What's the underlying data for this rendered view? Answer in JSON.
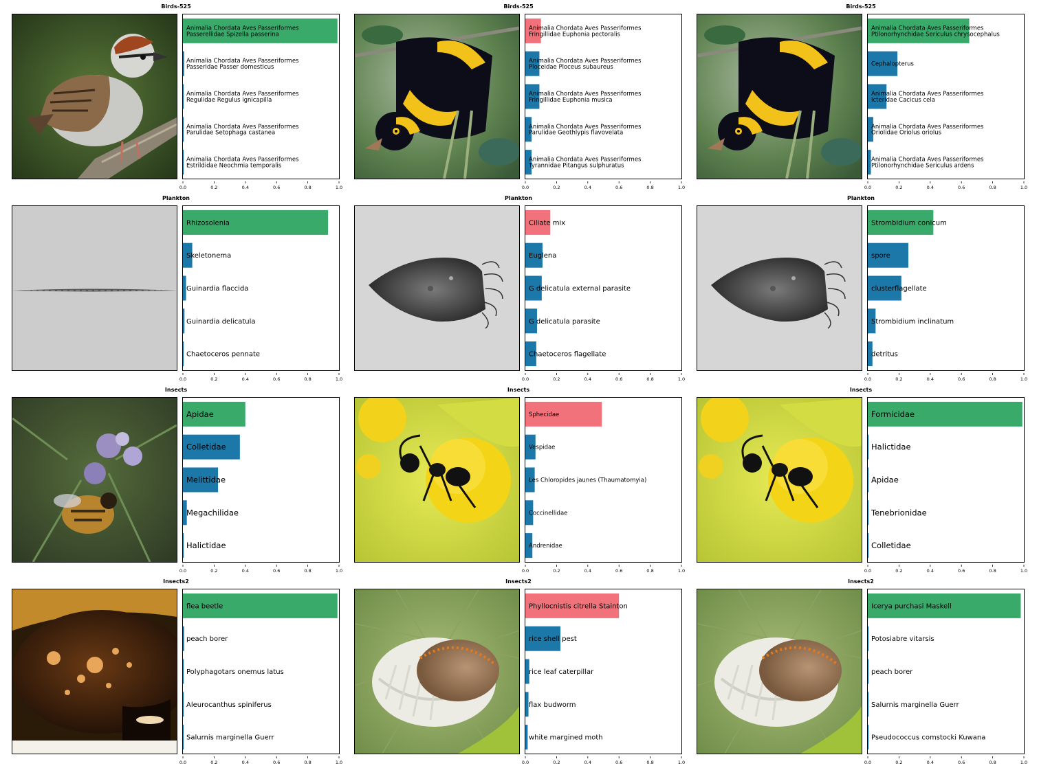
{
  "colors": {
    "correct": "#3aaa6b",
    "wrong": "#f2727c",
    "other": "#1c78a8"
  },
  "chart_data": [
    {
      "type": "bar",
      "title": "Birds-525",
      "image": "chipping-sparrow-photo",
      "xlim": [
        0,
        1
      ],
      "xticks": [
        "0.0",
        "0.2",
        "0.4",
        "0.6",
        "0.8",
        "1.0"
      ],
      "label_size": "small",
      "bars": [
        {
          "label": [
            "Animalia Chordata Aves Passeriformes",
            "Passerellidae Spizella passerina"
          ],
          "value": 0.99,
          "status": "correct"
        },
        {
          "label": [
            "Animalia Chordata Aves Passeriformes",
            "Passeridae Passer domesticus"
          ],
          "value": 0.008,
          "status": "other"
        },
        {
          "label": [
            "Animalia Chordata Aves Passeriformes",
            "Regulidae Regulus ignicapilla"
          ],
          "value": 0.005,
          "status": "other"
        },
        {
          "label": [
            "Animalia Chordata Aves Passeriformes",
            "Parulidae Setophaga castanea"
          ],
          "value": 0.004,
          "status": "other"
        },
        {
          "label": [
            "Animalia Chordata Aves Passeriformes",
            "Estrildidae Neochmia temporalis"
          ],
          "value": 0.003,
          "status": "other"
        }
      ]
    },
    {
      "type": "bar",
      "title": "Birds-525",
      "image": "bowerbird-photo",
      "xlim": [
        0,
        1
      ],
      "xticks": [
        "0.0",
        "0.2",
        "0.4",
        "0.6",
        "0.8",
        "1.0"
      ],
      "label_size": "small",
      "bars": [
        {
          "label": [
            "Animalia Chordata Aves Passeriformes",
            "Fringillidae Euphonia pectoralis"
          ],
          "value": 0.1,
          "status": "wrong"
        },
        {
          "label": [
            "Animalia Chordata Aves Passeriformes",
            "Ploceidae Ploceus subaureus"
          ],
          "value": 0.09,
          "status": "other"
        },
        {
          "label": [
            "Animalia Chordata Aves Passeriformes",
            "Fringillidae Euphonia musica"
          ],
          "value": 0.09,
          "status": "other"
        },
        {
          "label": [
            "Animalia Chordata Aves Passeriformes",
            "Parulidae Geothlypis flavovelata"
          ],
          "value": 0.04,
          "status": "other"
        },
        {
          "label": [
            "Animalia Chordata Aves Passeriformes",
            "Tyrannidae Pitangus sulphuratus"
          ],
          "value": 0.04,
          "status": "other"
        }
      ]
    },
    {
      "type": "bar",
      "title": "Birds-525",
      "image": "bowerbird-photo",
      "xlim": [
        0,
        1
      ],
      "xticks": [
        "0.0",
        "0.2",
        "0.4",
        "0.6",
        "0.8",
        "1.0"
      ],
      "label_size": "small",
      "bars": [
        {
          "label": [
            "Animalia Chordata Aves Passeriformes",
            "Ptilonorhynchidae Sericulus chrysocephalus"
          ],
          "value": 0.65,
          "status": "correct"
        },
        {
          "label": [
            "Cephalopterus"
          ],
          "value": 0.19,
          "status": "other"
        },
        {
          "label": [
            "Animalia Chordata Aves Passeriformes",
            "Icteridae Cacicus cela"
          ],
          "value": 0.12,
          "status": "other"
        },
        {
          "label": [
            "Animalia Chordata Aves Passeriformes",
            "Oriolidae Oriolus oriolus"
          ],
          "value": 0.035,
          "status": "other"
        },
        {
          "label": [
            "Animalia Chordata Aves Passeriformes",
            "Ptilonorhynchidae Sericulus ardens"
          ],
          "value": 0.02,
          "status": "other"
        }
      ]
    },
    {
      "type": "bar",
      "title": "Plankton",
      "image": "diatom-chain-micrograph",
      "xlim": [
        0,
        1
      ],
      "xticks": [
        "0.0",
        "0.2",
        "0.4",
        "0.6",
        "0.8",
        "1.0"
      ],
      "label_size": "medium",
      "bars": [
        {
          "label": [
            "Rhizosolenia"
          ],
          "value": 0.93,
          "status": "correct"
        },
        {
          "label": [
            "Skeletonema"
          ],
          "value": 0.06,
          "status": "other"
        },
        {
          "label": [
            "Guinardia flaccida"
          ],
          "value": 0.02,
          "status": "other"
        },
        {
          "label": [
            "Guinardia delicatula"
          ],
          "value": 0.01,
          "status": "other"
        },
        {
          "label": [
            "Chaetoceros pennate"
          ],
          "value": 0.004,
          "status": "other"
        }
      ]
    },
    {
      "type": "bar",
      "title": "Plankton",
      "image": "ciliate-micrograph",
      "xlim": [
        0,
        1
      ],
      "xticks": [
        "0.0",
        "0.2",
        "0.4",
        "0.6",
        "0.8",
        "1.0"
      ],
      "label_size": "medium",
      "bars": [
        {
          "label": [
            "Ciliate mix"
          ],
          "value": 0.16,
          "status": "wrong"
        },
        {
          "label": [
            "Euglena"
          ],
          "value": 0.11,
          "status": "other"
        },
        {
          "label": [
            "G delicatula external parasite"
          ],
          "value": 0.105,
          "status": "other"
        },
        {
          "label": [
            "G delicatula parasite"
          ],
          "value": 0.075,
          "status": "other"
        },
        {
          "label": [
            "Chaetoceros flagellate"
          ],
          "value": 0.07,
          "status": "other"
        }
      ]
    },
    {
      "type": "bar",
      "title": "Plankton",
      "image": "ciliate-micrograph",
      "xlim": [
        0,
        1
      ],
      "xticks": [
        "0.0",
        "0.2",
        "0.4",
        "0.6",
        "0.8",
        "1.0"
      ],
      "label_size": "medium",
      "bars": [
        {
          "label": [
            "Strombidium conicum"
          ],
          "value": 0.42,
          "status": "correct"
        },
        {
          "label": [
            "spore"
          ],
          "value": 0.26,
          "status": "other"
        },
        {
          "label": [
            "clusterflagellate"
          ],
          "value": 0.215,
          "status": "other"
        },
        {
          "label": [
            "Strombidium inclinatum"
          ],
          "value": 0.05,
          "status": "other"
        },
        {
          "label": [
            "detritus"
          ],
          "value": 0.03,
          "status": "other"
        }
      ]
    },
    {
      "type": "bar",
      "title": "Insects",
      "image": "bee-on-rosemary-photo",
      "xlim": [
        0,
        1
      ],
      "xticks": [
        "0.0",
        "0.2",
        "0.4",
        "0.6",
        "0.8",
        "1.0"
      ],
      "label_size": "large",
      "bars": [
        {
          "label": [
            "Apidae"
          ],
          "value": 0.4,
          "status": "correct"
        },
        {
          "label": [
            "Colletidae"
          ],
          "value": 0.365,
          "status": "other"
        },
        {
          "label": [
            "Melittidae"
          ],
          "value": 0.225,
          "status": "other"
        },
        {
          "label": [
            "Megachilidae"
          ],
          "value": 0.025,
          "status": "other"
        },
        {
          "label": [
            "Halictidae"
          ],
          "value": 0.005,
          "status": "other"
        }
      ]
    },
    {
      "type": "bar",
      "title": "Insects",
      "image": "ant-on-yellow-flower-photo",
      "xlim": [
        0,
        1
      ],
      "xticks": [
        "0.0",
        "0.2",
        "0.4",
        "0.6",
        "0.8",
        "1.0"
      ],
      "label_size": "small",
      "bars": [
        {
          "label": [
            "Sphecidae"
          ],
          "value": 0.49,
          "status": "wrong"
        },
        {
          "label": [
            "Vespidae"
          ],
          "value": 0.065,
          "status": "other"
        },
        {
          "label": [
            "Les Chloropides jaunes (Thaumatomyia)"
          ],
          "value": 0.06,
          "status": "other"
        },
        {
          "label": [
            "Coccinellidae"
          ],
          "value": 0.05,
          "status": "other"
        },
        {
          "label": [
            "Andrenidae"
          ],
          "value": 0.045,
          "status": "other"
        }
      ]
    },
    {
      "type": "bar",
      "title": "Insects",
      "image": "ant-on-yellow-flower-photo",
      "xlim": [
        0,
        1
      ],
      "xticks": [
        "0.0",
        "0.2",
        "0.4",
        "0.6",
        "0.8",
        "1.0"
      ],
      "label_size": "large",
      "bars": [
        {
          "label": [
            "Formicidae"
          ],
          "value": 0.99,
          "status": "correct"
        },
        {
          "label": [
            "Halictidae"
          ],
          "value": 0.004,
          "status": "other"
        },
        {
          "label": [
            "Apidae"
          ],
          "value": 0.003,
          "status": "other"
        },
        {
          "label": [
            "Tenebrionidae"
          ],
          "value": 0.002,
          "status": "other"
        },
        {
          "label": [
            "Colletidae"
          ],
          "value": 0.002,
          "status": "other"
        }
      ]
    },
    {
      "type": "bar",
      "title": "Insects2",
      "image": "beetle-closeup-photo",
      "xlim": [
        0,
        1
      ],
      "xticks": [
        "0.0",
        "0.2",
        "0.4",
        "0.6",
        "0.8",
        "1.0"
      ],
      "label_size": "medium",
      "bars": [
        {
          "label": [
            "flea beetle"
          ],
          "value": 0.99,
          "status": "correct"
        },
        {
          "label": [
            "peach borer"
          ],
          "value": 0.008,
          "status": "other"
        },
        {
          "label": [
            "Polyphagotars onemus latus"
          ],
          "value": 0.004,
          "status": "other"
        },
        {
          "label": [
            "Aleurocanthus spiniferus"
          ],
          "value": 0.002,
          "status": "other"
        },
        {
          "label": [
            "Salurnis marginella Guerr"
          ],
          "value": 0.002,
          "status": "other"
        }
      ]
    },
    {
      "type": "bar",
      "title": "Insects2",
      "image": "scale-insect-on-leaf-photo",
      "xlim": [
        0,
        1
      ],
      "xticks": [
        "0.0",
        "0.2",
        "0.4",
        "0.6",
        "0.8",
        "1.0"
      ],
      "label_size": "medium",
      "bars": [
        {
          "label": [
            "Phyllocnistis citrella Stainton"
          ],
          "value": 0.6,
          "status": "wrong"
        },
        {
          "label": [
            "rice shell pest"
          ],
          "value": 0.225,
          "status": "other"
        },
        {
          "label": [
            "rice leaf caterpillar"
          ],
          "value": 0.025,
          "status": "other"
        },
        {
          "label": [
            "flax budworm"
          ],
          "value": 0.02,
          "status": "other"
        },
        {
          "label": [
            "white margined moth"
          ],
          "value": 0.015,
          "status": "other"
        }
      ]
    },
    {
      "type": "bar",
      "title": "Insects2",
      "image": "scale-insect-on-leaf-photo",
      "xlim": [
        0,
        1
      ],
      "xticks": [
        "0.0",
        "0.2",
        "0.4",
        "0.6",
        "0.8",
        "1.0"
      ],
      "label_size": "medium",
      "bars": [
        {
          "label": [
            "Icerya purchasi Maskell"
          ],
          "value": 0.98,
          "status": "correct"
        },
        {
          "label": [
            "Potosiabre vitarsis"
          ],
          "value": 0.004,
          "status": "other"
        },
        {
          "label": [
            "peach borer"
          ],
          "value": 0.003,
          "status": "other"
        },
        {
          "label": [
            "Salurnis marginella Guerr"
          ],
          "value": 0.002,
          "status": "other"
        },
        {
          "label": [
            "Pseudococcus comstocki Kuwana"
          ],
          "value": 0.002,
          "status": "other"
        }
      ]
    }
  ]
}
